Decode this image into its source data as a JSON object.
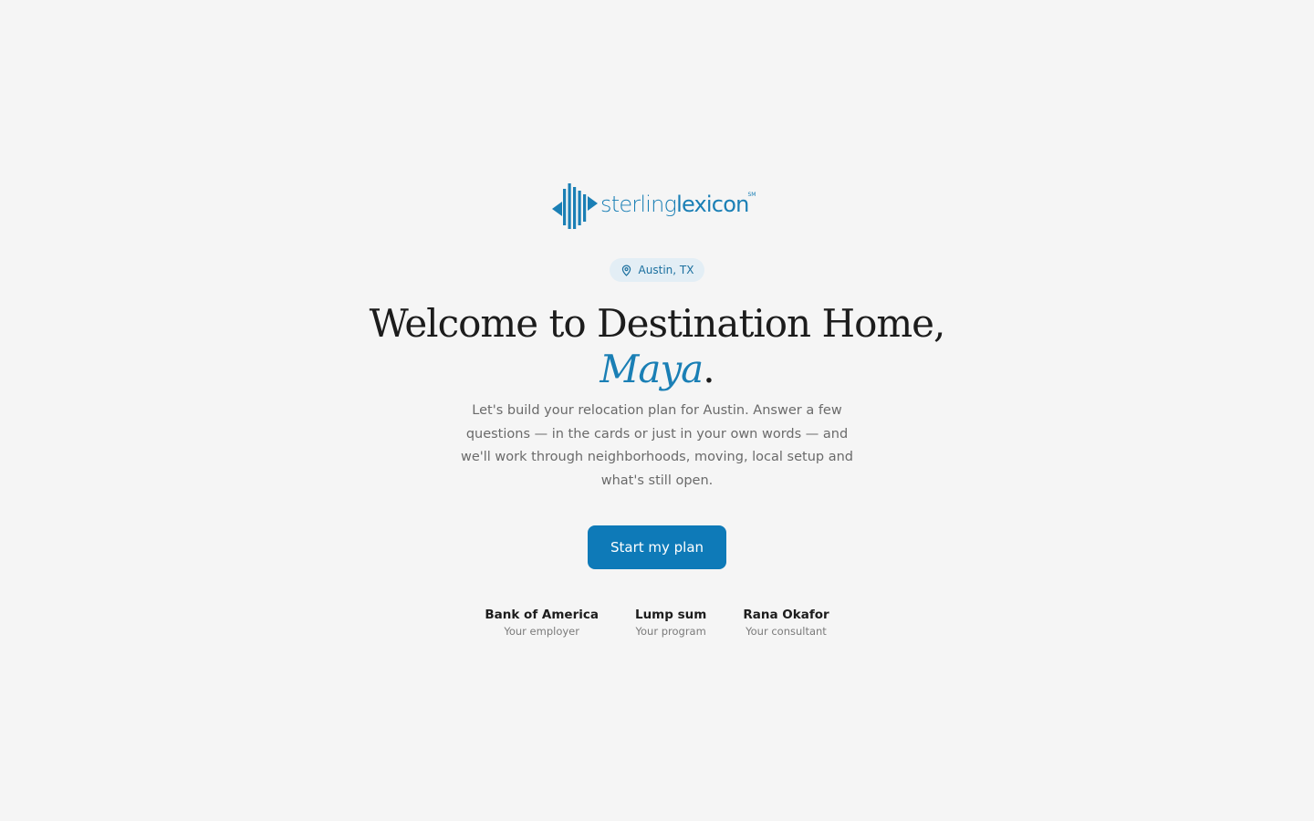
{
  "brand": {
    "name_light": "sterling",
    "name_bold": "lexicon",
    "mark": "SM",
    "color": "#1a7fb5"
  },
  "location": {
    "icon": "map-pin-icon",
    "label": "Austin, TX"
  },
  "headline": {
    "line1": "Welcome to Destination Home,",
    "name": "Maya",
    "punct": "."
  },
  "intro": "Let's build your relocation plan for Austin. Answer a few questions — in the cards or just in your own words — and we'll work through neighborhoods, moving, local setup and what's still open.",
  "cta": {
    "label": "Start my plan",
    "color": "#0e7ab8"
  },
  "facts": [
    {
      "value": "Bank of America",
      "label": "Your employer"
    },
    {
      "value": "Lump sum",
      "label": "Your program"
    },
    {
      "value": "Rana Okafor",
      "label": "Your consultant"
    }
  ]
}
